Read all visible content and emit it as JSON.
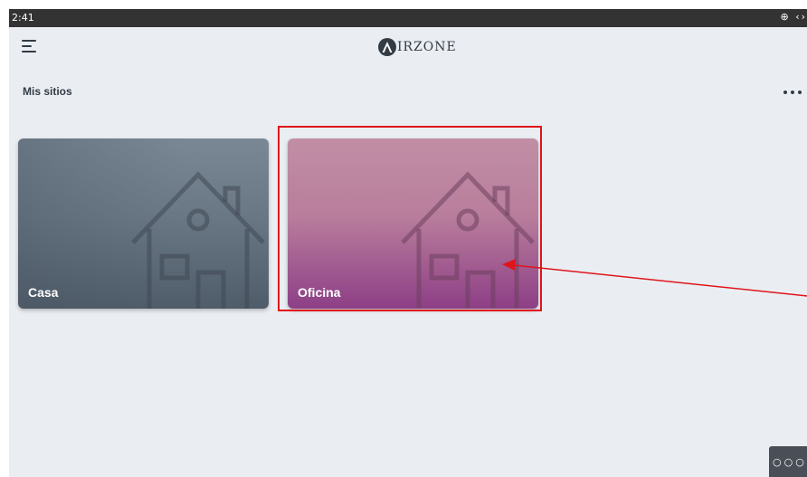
{
  "status_bar": {
    "time": "2:41",
    "icons": "⊕ ‹›"
  },
  "header": {
    "logo_letter": "A",
    "logo_text": "IRZONE"
  },
  "section": {
    "title": "Mis sitios"
  },
  "sites": [
    {
      "label": "Casa",
      "icon": "house-icon"
    },
    {
      "label": "Oficina",
      "icon": "house-icon"
    }
  ],
  "bottom_widget": {
    "label": "○○○"
  },
  "colors": {
    "background": "#eaeef3",
    "casa_card": "#6a7886",
    "oficina_card": "#b97e9c",
    "annotation": "#e0141c",
    "text_dark": "#333b45"
  }
}
